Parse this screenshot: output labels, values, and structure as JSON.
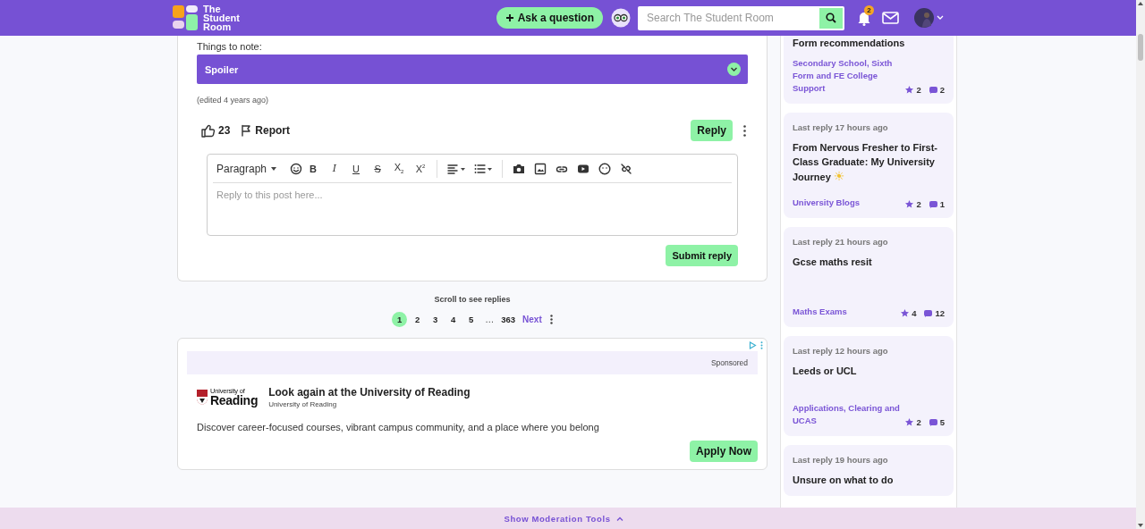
{
  "header": {
    "logo_text": "The Student Room",
    "ask_button": "Ask a question",
    "search": {
      "placeholder": "Search The Student Room"
    },
    "notification_count": "2"
  },
  "post": {
    "note_label": "Things to note:",
    "spoiler": {
      "label": "Spoiler",
      "expanded": false
    },
    "edited": "(edited 4 years ago)",
    "likes": "23",
    "report": "Report",
    "reply": "Reply",
    "editor": {
      "block_format": "Paragraph",
      "format_buttons": [
        {
          "label": "B",
          "kind": "bold"
        },
        {
          "label": "I",
          "kind": "italic"
        },
        {
          "label": "U",
          "kind": "underline"
        },
        {
          "label": "S",
          "kind": "strike"
        },
        {
          "label": "X$_{2}$",
          "kind": "plain"
        },
        {
          "label": "X$^{2}$",
          "kind": "plain"
        }
      ],
      "placeholder": "Reply to this post here...",
      "submit": "Submit reply"
    }
  },
  "replies_hint": "Scroll to see replies",
  "pagination": {
    "pages": [
      {
        "label": "1",
        "kind": "page",
        "selected": true
      },
      {
        "label": "2",
        "kind": "page",
        "selected": false
      },
      {
        "label": "3",
        "kind": "page",
        "selected": false
      },
      {
        "label": "4",
        "kind": "page",
        "selected": false
      },
      {
        "label": "5",
        "kind": "page",
        "selected": false
      },
      {
        "label": "…",
        "kind": "gap",
        "selected": false
      },
      {
        "label": "363",
        "kind": "page",
        "selected": false
      }
    ],
    "next": "Next"
  },
  "ad": {
    "sponsored": "Sponsored",
    "logo_top": "University of",
    "logo_bottom": "Reading",
    "headline": "Look again at the University of Reading",
    "advertiser": "University of Reading",
    "body": "Discover career-focused courses, vibrant campus community, and a place where you belong",
    "cta": "Apply Now"
  },
  "sidebar": {
    "threads": [
      {
        "title": "Form recommendations",
        "forum": "Secondary School, Sixth Form and FE College Support",
        "upvotes": "2",
        "replies": "2"
      },
      {
        "last_reply": "Last reply 17 hours ago",
        "title": "From Nervous Fresher to First-Class Graduate: My University Journey",
        "emoji": "☀",
        "forum": "University Blogs",
        "upvotes": "2",
        "replies": "1"
      },
      {
        "last_reply": "Last reply 21 hours ago",
        "title": "Gcse maths resit",
        "forum": "Maths Exams",
        "upvotes": "4",
        "replies": "12"
      },
      {
        "last_reply": "Last reply 12 hours ago",
        "title": "Leeds or UCL",
        "forum": "Applications, Clearing and UCAS",
        "upvotes": "2",
        "replies": "5"
      },
      {
        "last_reply": "Last reply 19 hours ago",
        "title": "Unsure on what to do"
      }
    ]
  },
  "moderation_bar": {
    "label": "Show Moderation Tools"
  }
}
